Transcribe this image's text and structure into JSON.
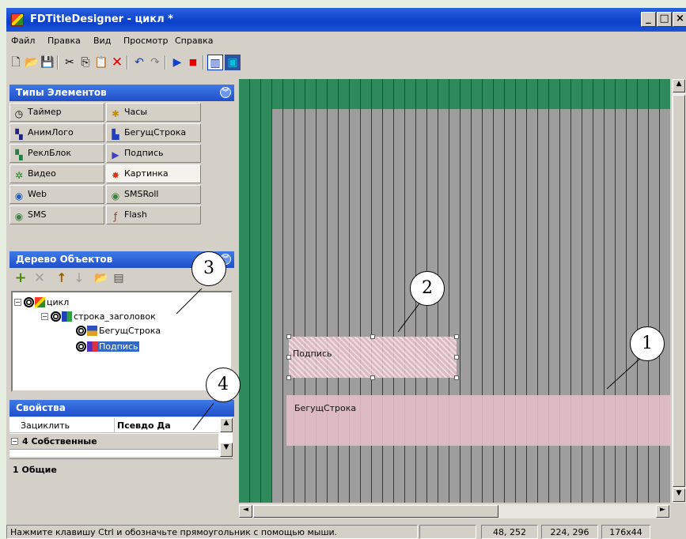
{
  "window": {
    "title": "FDTitleDesigner - цикл *",
    "controls": [
      "_",
      "□",
      "×"
    ]
  },
  "menu": {
    "items": [
      {
        "label": "Файл"
      },
      {
        "label": "Правка"
      },
      {
        "label": "Вид"
      },
      {
        "label": "Просмотр"
      },
      {
        "label": "Справка"
      }
    ]
  },
  "toolbar": {
    "buttons": [
      {
        "name": "new-file-icon",
        "glyph": "🗋"
      },
      {
        "name": "open-folder-icon",
        "glyph": "📂"
      },
      {
        "name": "save-icon",
        "glyph": "💾"
      },
      {
        "name": "cut-icon",
        "glyph": "✂"
      },
      {
        "name": "copy-icon",
        "glyph": "⎘"
      },
      {
        "name": "paste-icon",
        "glyph": "📋"
      },
      {
        "name": "delete-icon",
        "glyph": "✕"
      },
      {
        "name": "undo-icon",
        "glyph": "↶"
      },
      {
        "name": "redo-icon",
        "glyph": "↷"
      },
      {
        "name": "play-icon",
        "glyph": "▶"
      },
      {
        "name": "stop-icon",
        "glyph": "■"
      },
      {
        "name": "grid-view-icon",
        "glyph": "▥"
      },
      {
        "name": "frame-view-icon",
        "glyph": "▣"
      }
    ]
  },
  "element_types": {
    "title": "Типы Элементов",
    "items": [
      {
        "label": "Таймер",
        "icon": "timer-icon",
        "glyph": "◷",
        "color": "#000000"
      },
      {
        "label": "Часы",
        "icon": "clock-icon",
        "glyph": "✱",
        "color": "#c09000"
      },
      {
        "label": "АнимЛого",
        "icon": "anim-logo-icon",
        "glyph": "▚",
        "color": "#202080"
      },
      {
        "label": "БегущСтрока",
        "icon": "running-line-icon",
        "glyph": "▙",
        "color": "#2040c0"
      },
      {
        "label": "РеклБлок",
        "icon": "ad-block-icon",
        "glyph": "▚",
        "color": "#208040"
      },
      {
        "label": "Подпись",
        "icon": "caption-icon",
        "glyph": "▶",
        "color": "#4040c0"
      },
      {
        "label": "Видео",
        "icon": "video-icon",
        "glyph": "✲",
        "color": "#208020"
      },
      {
        "label": "Картинка",
        "icon": "picture-icon",
        "glyph": "✸",
        "color": "#e03010"
      },
      {
        "label": "Web",
        "icon": "web-icon",
        "glyph": "◉",
        "color": "#2060c0"
      },
      {
        "label": "SMSRoll",
        "icon": "smsroll-icon",
        "glyph": "◉",
        "color": "#408040"
      },
      {
        "label": "SMS",
        "icon": "sms-icon",
        "glyph": "◉",
        "color": "#408040"
      },
      {
        "label": "Flash",
        "icon": "flash-icon",
        "glyph": "ƒ",
        "color": "#c02020"
      }
    ]
  },
  "object_tree": {
    "title": "Дерево Объектов",
    "nodes": [
      {
        "label": "цикл"
      },
      {
        "label": "строка_заголовок"
      },
      {
        "label": "БегущСтрока"
      },
      {
        "label": "Подпись"
      }
    ]
  },
  "properties": {
    "title": "Свойства",
    "row_name": "Зациклить",
    "row_value": "Псевдо Да",
    "group_label": "4 Собственные",
    "general_label": "1 Общие"
  },
  "canvas": {
    "caption_object": "Подпись",
    "running_object": "БегущСтрока"
  },
  "callouts": [
    "1",
    "2",
    "3",
    "4"
  ],
  "status": {
    "hint": "Нажмите клавишу Ctrl и обозначьте прямоугольник с помощью мыши.",
    "coords": "48, 252",
    "corner": "224, 296",
    "size": "176x44"
  }
}
